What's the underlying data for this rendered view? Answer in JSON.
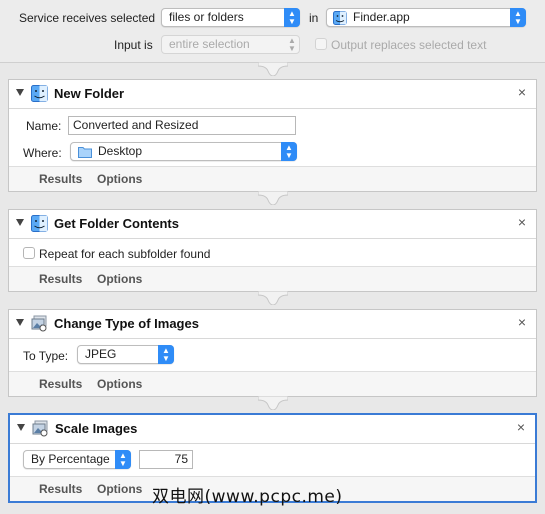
{
  "header": {
    "service_label": "Service receives selected",
    "service_value": "files or folders",
    "in_label": "in",
    "app_value": "Finder.app",
    "input_is_label": "Input is",
    "input_is_value": "entire selection",
    "output_replaces_label": "Output replaces selected text"
  },
  "actions": [
    {
      "title": "New Folder",
      "icon": "finder-icon",
      "name_label": "Name:",
      "name_value": "Converted and Resized",
      "where_label": "Where:",
      "where_value": "Desktop",
      "results_label": "Results",
      "options_label": "Options"
    },
    {
      "title": "Get Folder Contents",
      "icon": "finder-icon",
      "repeat_label": "Repeat for each subfolder found",
      "results_label": "Results",
      "options_label": "Options"
    },
    {
      "title": "Change Type of Images",
      "icon": "preview-icon",
      "to_type_label": "To Type:",
      "to_type_value": "JPEG",
      "results_label": "Results",
      "options_label": "Options"
    },
    {
      "title": "Scale Images",
      "icon": "preview-icon",
      "scale_mode_value": "By Percentage",
      "scale_amount_value": "75",
      "results_label": "Results",
      "options_label": "Options"
    }
  ],
  "close_glyph": "×",
  "watermark": "双电网(www.pcpc.me)",
  "colors": {
    "accent": "#2f8cf7",
    "selection_border": "#3a7bd5"
  }
}
